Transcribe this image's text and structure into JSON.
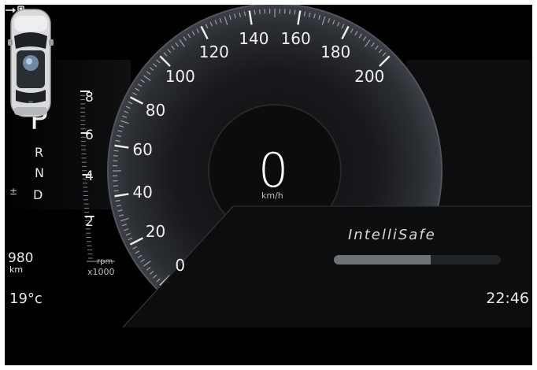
{
  "gear_selector": {
    "active": "P",
    "r": "R",
    "n": "N",
    "d": "D",
    "manual_shift": "± "
  },
  "tachometer": {
    "ticks": [
      "8",
      "6",
      "4",
      "2"
    ],
    "unit": "rpm",
    "multiplier": "x1000"
  },
  "speedometer": {
    "labels": [
      "0",
      "20",
      "40",
      "60",
      "80",
      "100",
      "120",
      "140",
      "160",
      "180",
      "200"
    ],
    "current_speed": "0",
    "unit": "km/h"
  },
  "range": {
    "value": "980",
    "unit": "km"
  },
  "outside_temp": "19°c",
  "clock": "22:46",
  "intellisafe": {
    "title": "IntelliSafe",
    "level": 0.58
  },
  "icons": [
    "fuel-pump-icon",
    "car-top-view-icon",
    "manual-shift-icon"
  ],
  "colors": {
    "background": "#000000",
    "text": "#e6e6e6",
    "bar_fill": "#6c7278",
    "bar_track": "#202326"
  }
}
